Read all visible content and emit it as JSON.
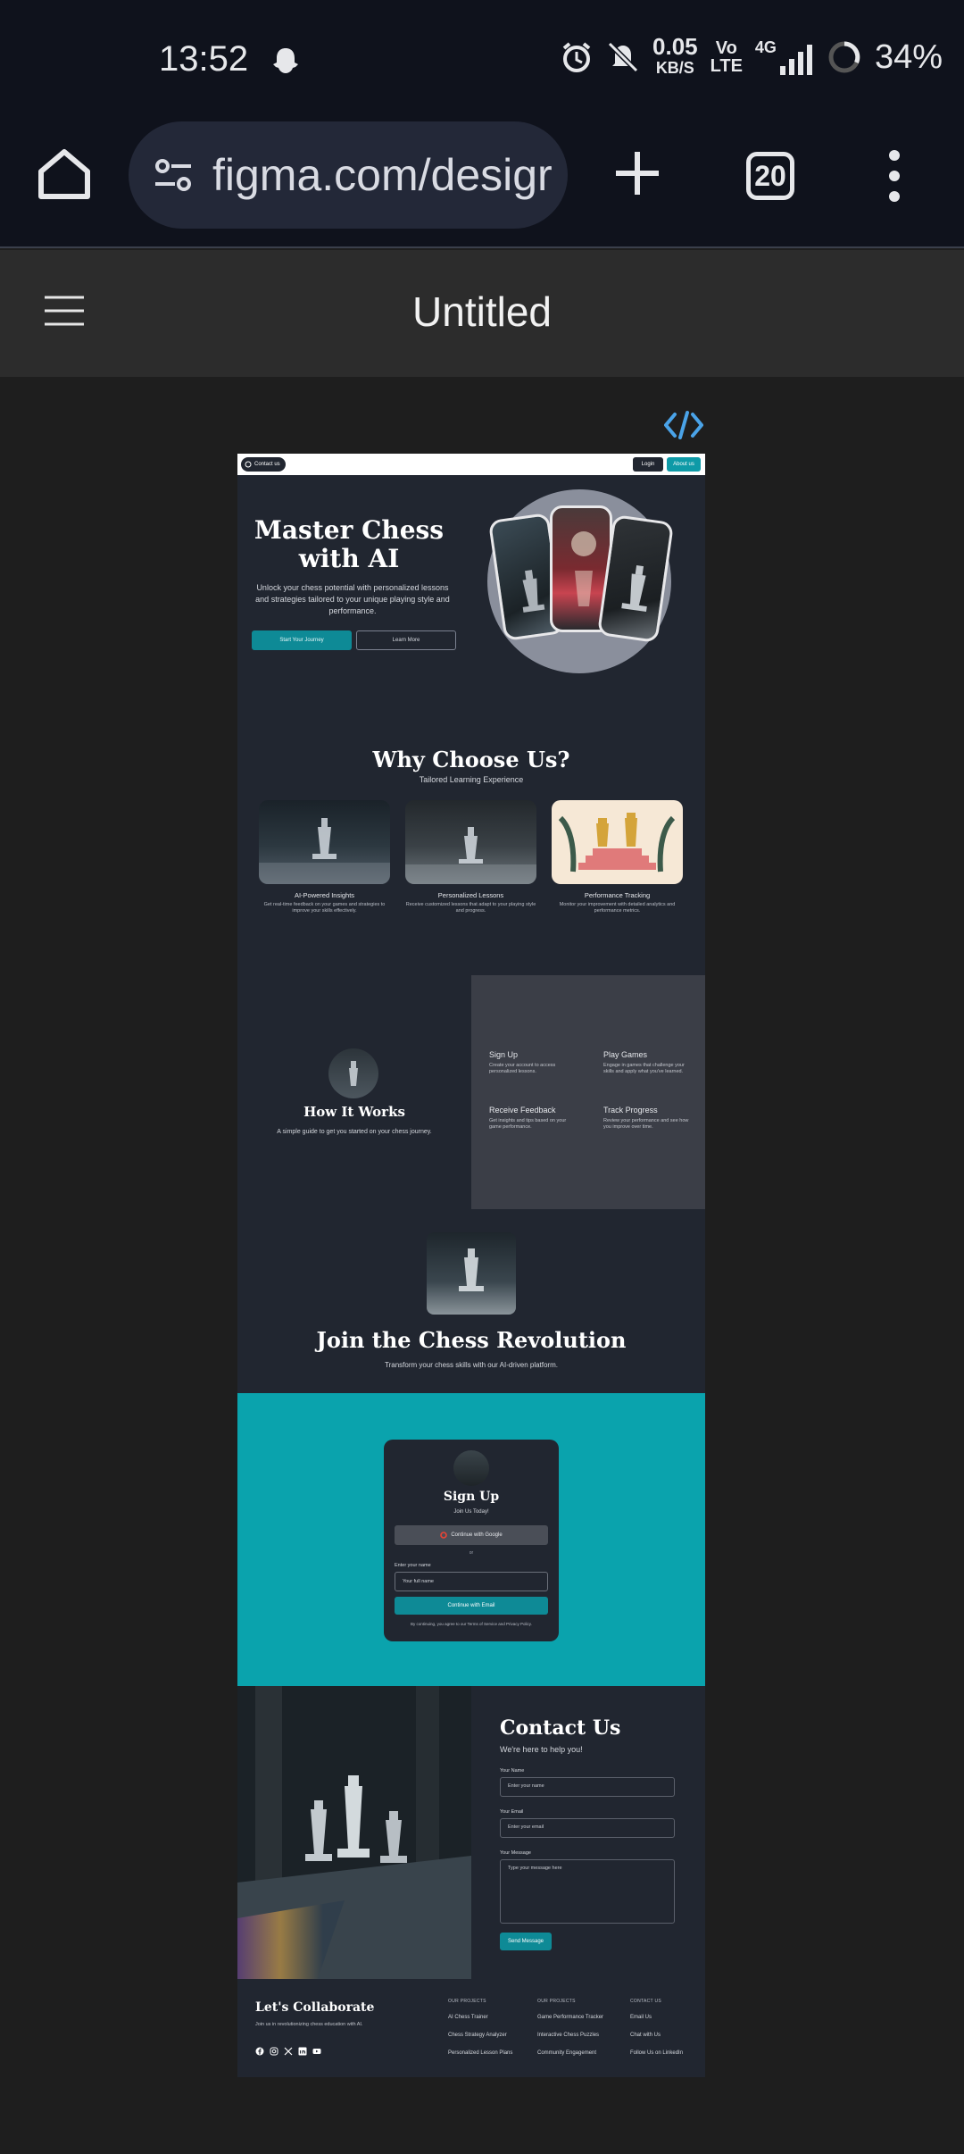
{
  "status_bar": {
    "time": "13:52",
    "net_speed_value": "0.05",
    "net_speed_unit": "KB/S",
    "volte_top": "Vo",
    "volte_bottom": "LTE",
    "network": "4G",
    "battery": "34%",
    "icons": [
      "snapchat-ghost-icon",
      "alarm-icon",
      "mute-icon",
      "signal-icon",
      "battery-ring-icon"
    ]
  },
  "browser": {
    "url": "figma.com/desigr",
    "tab_count": "20",
    "icons": [
      "home-icon",
      "site-settings-icon",
      "new-tab-icon",
      "overflow-menu-icon"
    ]
  },
  "figma": {
    "file_title": "Untitled",
    "icons": [
      "hamburger-icon",
      "code-view-icon"
    ]
  },
  "design": {
    "nav": {
      "contact": "Contact us",
      "login": "Login",
      "about": "About us"
    },
    "hero": {
      "title_line1": "Master Chess",
      "title_line2": "with AI",
      "subtitle": "Unlock your chess potential with personalized lessons and strategies tailored to your unique playing style and performance.",
      "primary_cta": "Start Your Journey",
      "secondary_cta": "Learn More"
    },
    "why": {
      "title": "Why Choose Us?",
      "subtitle": "Tailored Learning Experience",
      "features": [
        {
          "title": "AI-Powered Insights",
          "desc": "Get real-time feedback on your games and strategies to improve your skills effectively."
        },
        {
          "title": "Personalized Lessons",
          "desc": "Receive customized lessons that adapt to your playing style and progress."
        },
        {
          "title": "Performance Tracking",
          "desc": "Monitor your improvement with detailed analytics and performance metrics."
        }
      ]
    },
    "how": {
      "title": "How It Works",
      "subtitle": "A simple guide to get you started on your chess journey.",
      "steps": [
        {
          "title": "Sign Up",
          "desc": "Create your account to access personalized lessons."
        },
        {
          "title": "Play Games",
          "desc": "Engage in games that challenge your skills and apply what you've learned."
        },
        {
          "title": "Receive Feedback",
          "desc": "Get insights and tips based on your game performance."
        },
        {
          "title": "Track Progress",
          "desc": "Review your performance and see how you improve over time."
        }
      ]
    },
    "revolution": {
      "title": "Join the Chess Revolution",
      "subtitle": "Transform your chess skills with our AI-driven platform."
    },
    "signup": {
      "title": "Sign Up",
      "subtitle": "Join Us Today!",
      "google_btn": "Continue with Google",
      "divider": "or",
      "name_label": "Enter your name",
      "name_placeholder": "Your full name",
      "email_btn": "Continue with Email",
      "terms": "By continuing, you agree to our Terms of Service and Privacy Policy."
    },
    "contact": {
      "title": "Contact Us",
      "subtitle": "We're here to help you!",
      "name_label": "Your Name",
      "name_placeholder": "Enter your name",
      "email_label": "Your Email",
      "email_placeholder": "Enter your email",
      "message_label": "Your Message",
      "message_placeholder": "Type your message here",
      "send": "Send Message"
    },
    "footer": {
      "title": "Let's Collaborate",
      "tagline": "Join us in revolutionizing chess education with AI.",
      "col1_head": "OUR PROJECTS",
      "col1": [
        "AI Chess Trainer",
        "Chess Strategy Analyzer",
        "Personalized Lesson Plans"
      ],
      "col2_head": "OUR PROJECTS",
      "col2": [
        "Game Performance Tracker",
        "Interactive Chess Puzzles",
        "Community Engagement"
      ],
      "col3_head": "CONTACT US",
      "col3": [
        "Email Us",
        "Chat with Us",
        "Follow Us on LinkedIn"
      ],
      "social": [
        "facebook-icon",
        "instagram-icon",
        "x-icon",
        "linkedin-icon",
        "youtube-icon"
      ]
    },
    "colors": {
      "background": "#212630",
      "accent": "#0e9aa7",
      "signup_band": "#0aa3ad",
      "panel": "#3b3e47"
    }
  }
}
